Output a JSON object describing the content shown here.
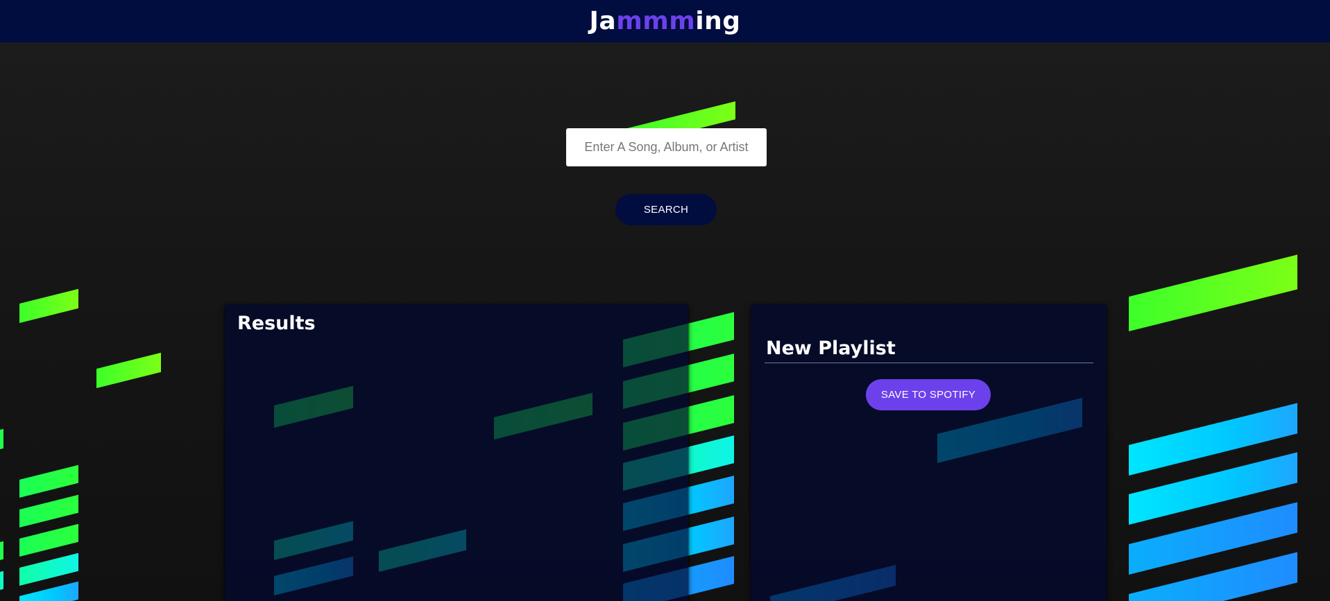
{
  "header": {
    "brand_start": "Ja",
    "brand_accent": "mmm",
    "brand_end": "ing"
  },
  "search": {
    "placeholder": "Enter A Song, Album, or Artist",
    "button_label": "SEARCH"
  },
  "results": {
    "title": "Results"
  },
  "playlist": {
    "name": "New Playlist",
    "save_label": "SAVE TO SPOTIFY"
  },
  "colors": {
    "header_bg": "#010c3f",
    "accent": "#6c41ec",
    "panel_bg": "#010830"
  }
}
